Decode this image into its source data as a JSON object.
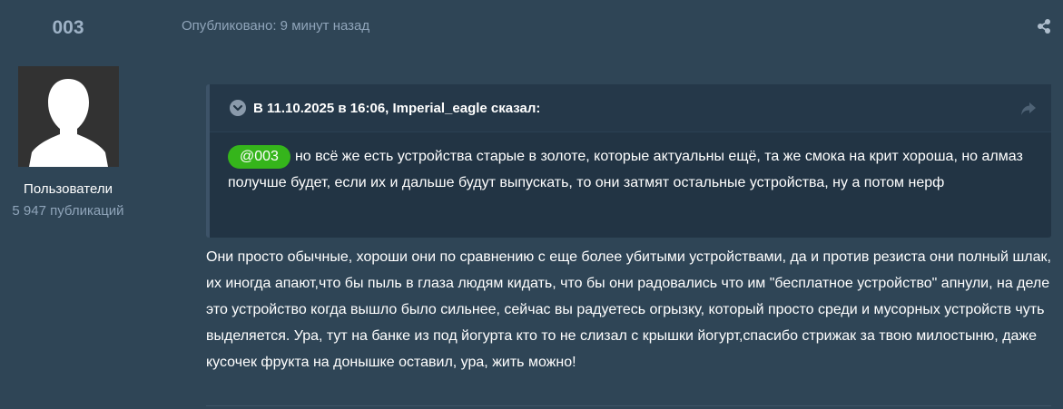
{
  "author": {
    "username": "003",
    "group": "Пользователи",
    "post_count": "5 947 публикаций",
    "avatar_icon": "default-user-silhouette"
  },
  "post_meta": {
    "published": "Опубликовано: 9 минут назад",
    "share_icon": "share-icon"
  },
  "quote": {
    "prefix": "В 11.10.2025 в 16:06, ",
    "author": "Imperial_eagle",
    "suffix": " сказал:",
    "mention": "@003",
    "text": "но всё же есть устройства старые в золоте, которые актуальны ещё, та же смока на крит хороша, но алмаз получше будет, если их и дальше будут выпускать, то они затмят остальные устройства, ну а потом нерф",
    "toggle_icon": "chevron-down-icon",
    "goto_icon": "share-arrow-icon"
  },
  "reply": {
    "text": "Они просто обычные, хороши они по сравнению с еще более убитыми устройствами, да и против резиста они полный шлак, их иногда апают,что бы пыль в глаза людям кидать, что бы они радовались что им \"бесплатное устройство\" апнули, на деле это устройство когда вышло было сильнее, сейчас вы радуетесь огрызку, который просто среди и мусорных устройств чуть выделяется. Ура, тут на банке из под йогурта кто то не слизал с крышки йогурт,спасибо стрижак за твою милостыню, даже кусочек фрукта на донышке оставил, ура, жить можно!"
  },
  "colors": {
    "background": "#2f4556",
    "quote_background": "#223444",
    "mention": "#35b51b",
    "muted_text": "#8fa4b9"
  }
}
